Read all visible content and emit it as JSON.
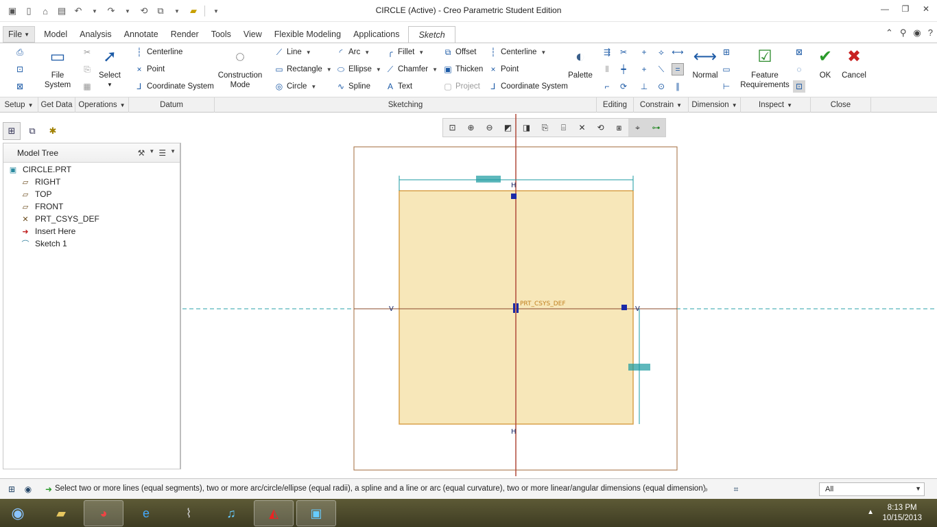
{
  "window": {
    "title": "CIRCLE (Active) - Creo Parametric Student Edition"
  },
  "tabs": {
    "file": "File",
    "items": [
      "Model",
      "Analysis",
      "Annotate",
      "Render",
      "Tools",
      "View",
      "Flexible Modeling",
      "Applications"
    ],
    "active": "Sketch"
  },
  "ribbon": {
    "setup": {
      "file_system": "File\nSystem",
      "group": "Setup"
    },
    "get_data": {
      "group": "Get Data"
    },
    "operations": {
      "select": "Select",
      "group": "Operations"
    },
    "datum": {
      "centerline": "Centerline",
      "point": "Point",
      "coordinate_system": "Coordinate System",
      "group": "Datum"
    },
    "sketching": {
      "construction_mode": "Construction\nMode",
      "line": "Line",
      "rectangle": "Rectangle",
      "circle": "Circle",
      "arc": "Arc",
      "ellipse": "Ellipse",
      "spline": "Spline",
      "fillet": "Fillet",
      "chamfer": "Chamfer",
      "text": "Text",
      "offset": "Offset",
      "thicken": "Thicken",
      "project": "Project",
      "centerline": "Centerline",
      "point": "Point",
      "coordinate_system": "Coordinate System",
      "palette": "Palette",
      "group": "Sketching"
    },
    "editing": {
      "group": "Editing"
    },
    "constrain": {
      "group": "Constrain"
    },
    "dimension": {
      "normal": "Normal",
      "group": "Dimension"
    },
    "inspect": {
      "feature_requirements": "Feature\nRequirements",
      "group": "Inspect"
    },
    "close": {
      "ok": "OK",
      "cancel": "Cancel",
      "group": "Close"
    }
  },
  "model_tree": {
    "title": "Model Tree",
    "items": [
      {
        "label": "CIRCLE.PRT",
        "icon": "part-icon"
      },
      {
        "label": "RIGHT",
        "icon": "datum-plane-icon"
      },
      {
        "label": "TOP",
        "icon": "datum-plane-icon"
      },
      {
        "label": "FRONT",
        "icon": "datum-plane-icon"
      },
      {
        "label": "PRT_CSYS_DEF",
        "icon": "csys-icon"
      },
      {
        "label": "Insert Here",
        "icon": "insert-arrow-icon"
      },
      {
        "label": "Sketch 1",
        "icon": "sketch-icon"
      }
    ]
  },
  "canvas": {
    "csys_label": "PRT_CSYS_DEF"
  },
  "status": {
    "message": "Select two or more lines (equal segments), two or more arc/circle/ellipse (equal radii), a spline and a line or arc (equal curvature), two or more linear/angular dimensions (equal dimension)",
    "filter_value": "All"
  },
  "taskbar": {
    "time": "8:13 PM",
    "date": "10/15/2013"
  },
  "colors": {
    "sketch_fill": "#f7e7b9",
    "sketch_edge": "#d8a04a",
    "dimension": "#1a9aa0",
    "axis_v": "#b04a3a",
    "reference": "#2aa0a8"
  }
}
